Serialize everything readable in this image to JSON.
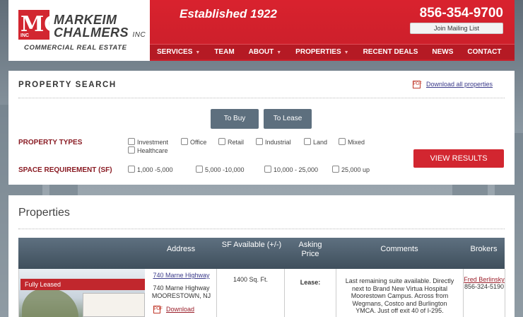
{
  "header": {
    "logo_name_1": "MARKEIM",
    "logo_name_2": "CHALMERS",
    "logo_inc": "INC",
    "logo_mark": "MC",
    "logo_mark_inc": "INC",
    "tagline": "COMMERCIAL REAL ESTATE",
    "established": "Established 1922",
    "phone": "856-354-9700",
    "mailing_button": "Join Mailing List",
    "nav": [
      {
        "label": "SERVICES",
        "has_dropdown": true
      },
      {
        "label": "TEAM",
        "has_dropdown": false
      },
      {
        "label": "ABOUT",
        "has_dropdown": true
      },
      {
        "label": "PROPERTIES",
        "has_dropdown": true
      },
      {
        "label": "RECENT DEALS",
        "has_dropdown": false
      },
      {
        "label": "NEWS",
        "has_dropdown": false
      },
      {
        "label": "CONTACT",
        "has_dropdown": false
      }
    ]
  },
  "search": {
    "title": "PROPERTY SEARCH",
    "download_all": "Download all properties",
    "tabs": [
      "To Buy",
      "To Lease"
    ],
    "property_types_label": "PROPERTY TYPES",
    "property_types": [
      "Investment",
      "Office",
      "Retail",
      "Industrial",
      "Land",
      "Mixed",
      "Healthcare"
    ],
    "space_label": "SPACE REQUIREMENT (SF)",
    "space_options": [
      "1,000 -5,000",
      "5,000 -10,000",
      "10,000 - 25,000",
      "25,000 up"
    ],
    "view_results": "VIEW RESULTS"
  },
  "properties": {
    "title": "Properties",
    "columns": {
      "address": "Address",
      "sf": "SF Available (+/-)",
      "price": "Asking Price",
      "comments": "Comments",
      "brokers": "Brokers"
    },
    "rows": [
      {
        "badge": "Fully Leased",
        "address_link": "740 Marne Highway",
        "address_line1": "740 Marne Highway",
        "address_line2": "MOORESTOWN, NJ",
        "download": "Download",
        "sf": "1400 Sq. Ft.",
        "price": "Lease:",
        "comments": "Last remaining suite available. Directly next to Brand New Virtua Hospital Moorestown Campus. Across from Wegmans, Costco and Burlington YMCA. Just off exit 40 of I-295.",
        "broker_name": "Fred Berlinsky",
        "broker_phone": "856-324-5190"
      }
    ]
  },
  "colors": {
    "brand_red": "#d22630",
    "nav_red": "#b51a24",
    "tab_gray": "#5d6f7e",
    "table_header": "#4a5a67"
  },
  "icons": [
    "pdf-icon",
    "checkbox-icon",
    "dropdown-caret-icon"
  ]
}
